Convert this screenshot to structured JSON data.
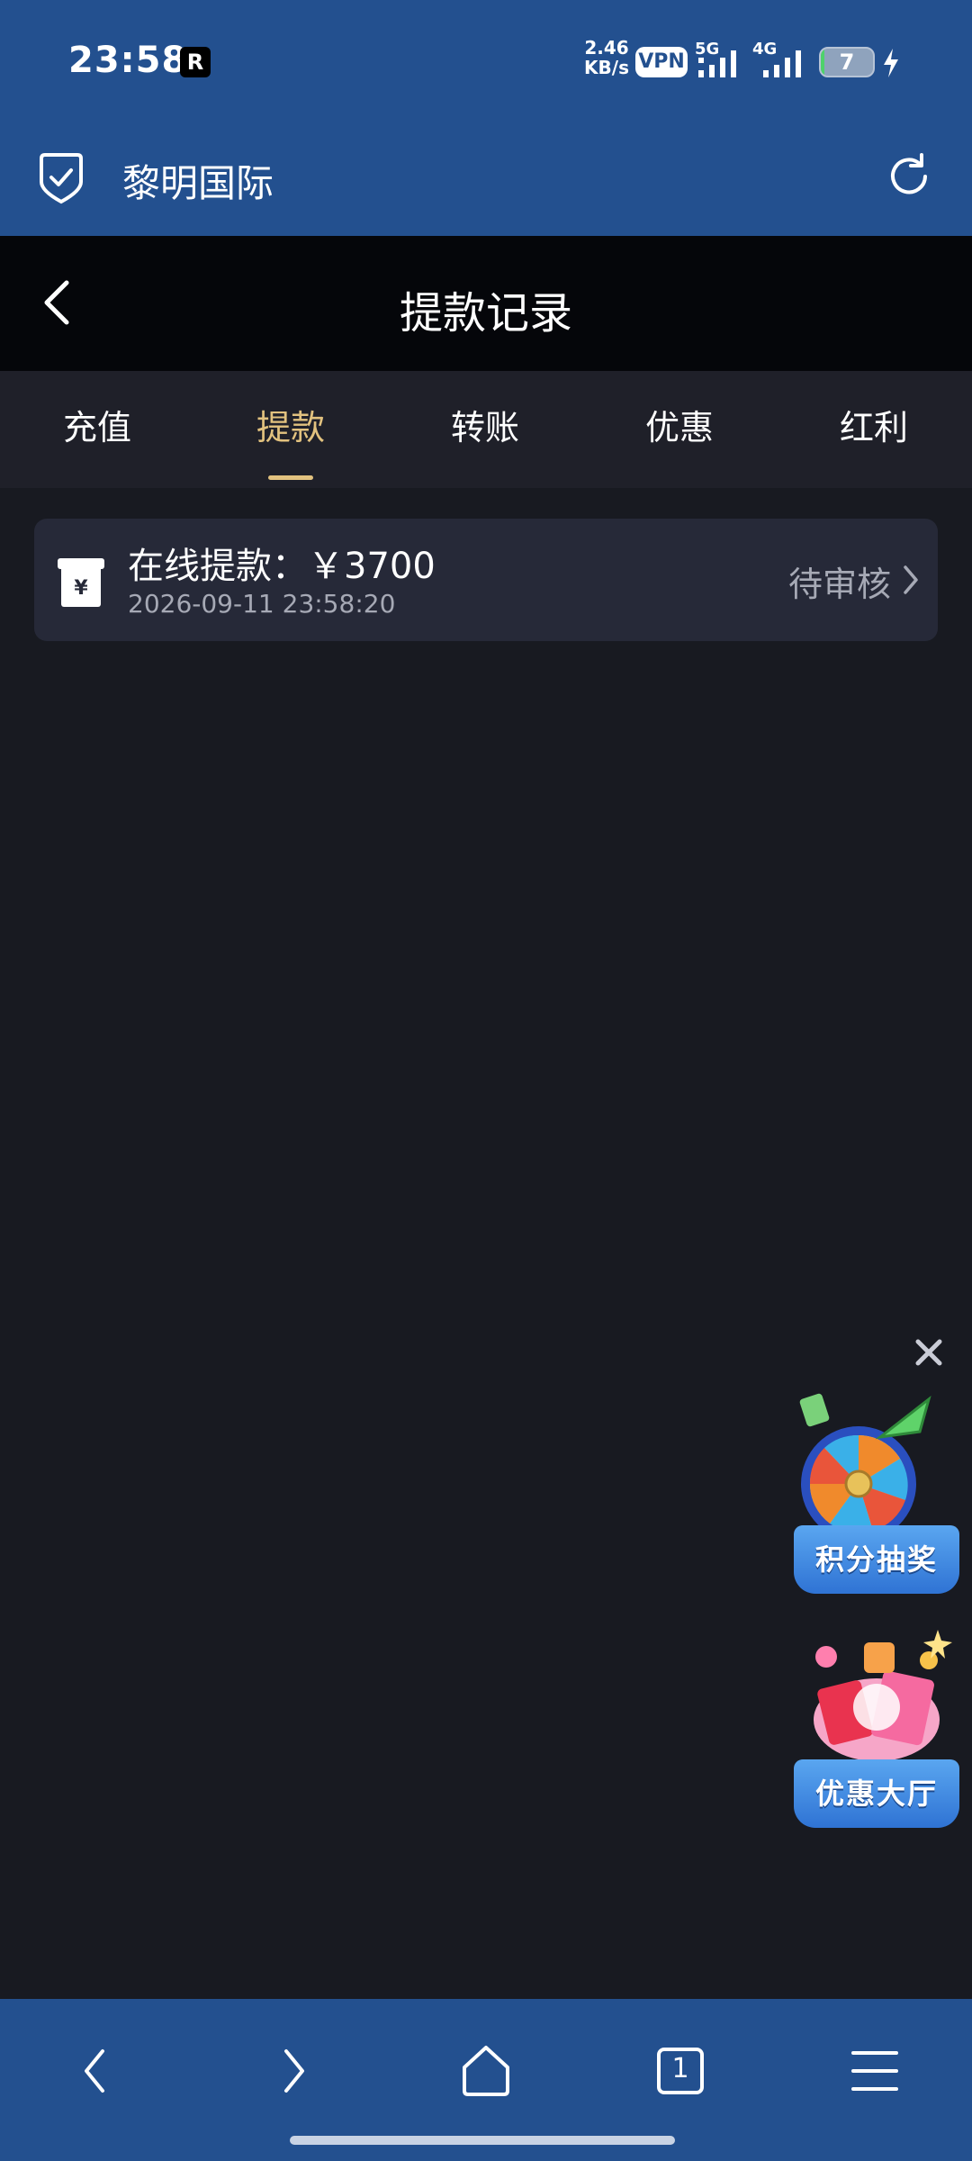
{
  "status_bar": {
    "time": "23:58",
    "notification_badge": "R",
    "net_speed_value": "2.46",
    "net_speed_unit": "KB/s",
    "vpn": "VPN",
    "net_type_1": "5G",
    "net_type_2": "4G",
    "battery": "7",
    "battery_level": 0.07
  },
  "browser": {
    "site_title": "黎明国际"
  },
  "header": {
    "title": "提款记录"
  },
  "tabs": [
    {
      "label": "充值",
      "active": false
    },
    {
      "label": "提款",
      "active": true
    },
    {
      "label": "转账",
      "active": false
    },
    {
      "label": "优惠",
      "active": false
    },
    {
      "label": "红利",
      "active": false
    }
  ],
  "records": [
    {
      "title": "在线提款：￥3700",
      "time": "2026-09-11 23:58:20",
      "status": "待审核"
    }
  ],
  "floating": {
    "lottery_label": "积分抽奖",
    "promo_label": "优惠大厅"
  },
  "bottom_nav": {
    "tab_count": "1"
  },
  "colors": {
    "brand_blue": "#23508f",
    "accent_gold": "#e2c27f",
    "background": "#181a21",
    "card": "#262938"
  }
}
